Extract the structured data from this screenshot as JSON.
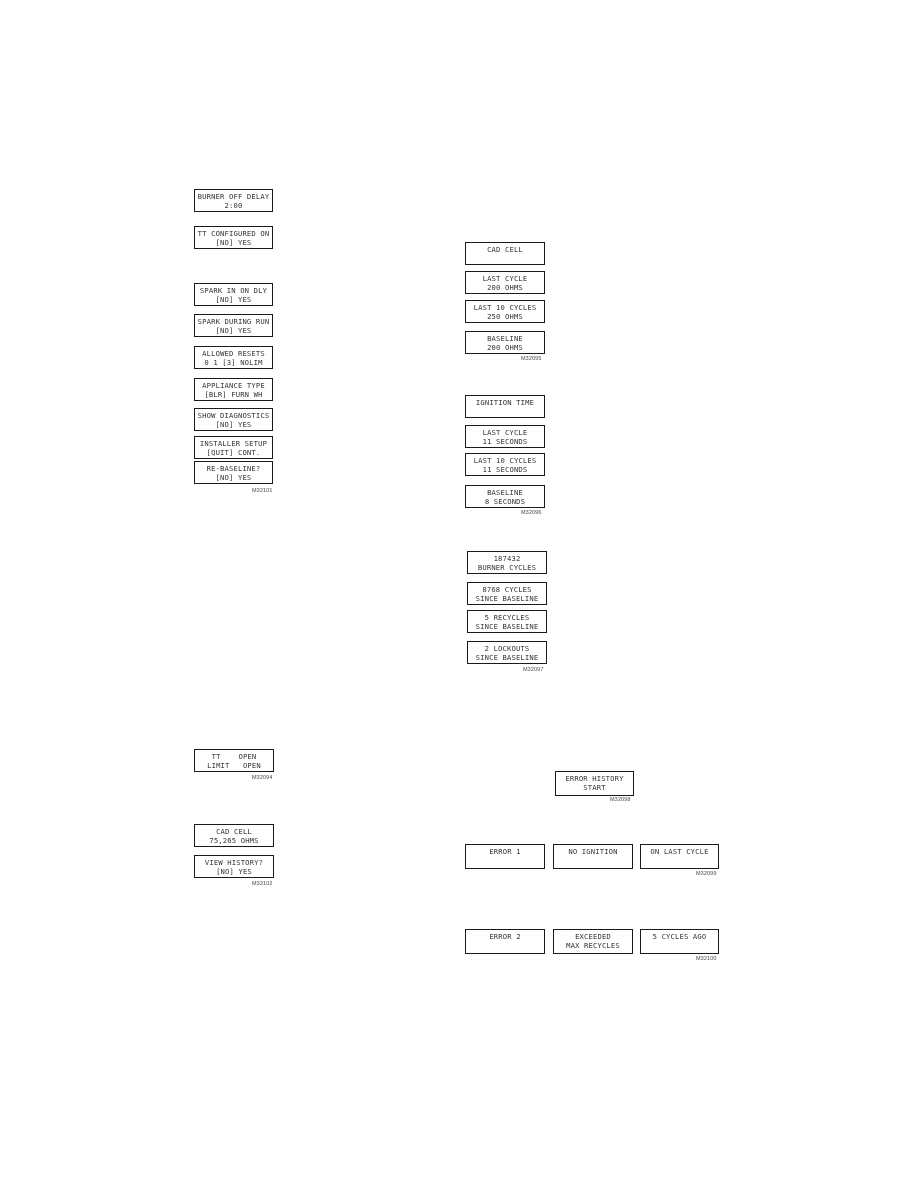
{
  "left_column": {
    "settings_group_a": [
      {
        "line1": "BURNER OFF DELAY",
        "line2": "2:00"
      },
      {
        "line1": "TT CONFIGURED ON",
        "line2": "[NO] YES"
      }
    ],
    "settings_group_b": [
      {
        "line1": "SPARK IN ON DLY",
        "line2": "[NO] YES"
      },
      {
        "line1": "SPARK DURING RUN",
        "line2": "[NO] YES"
      },
      {
        "line1": "ALLOWED RESETS",
        "line2": "0 1 [3] NOLIM"
      },
      {
        "line1": "APPLIANCE TYPE",
        "line2": "[BLR] FURN WH"
      },
      {
        "line1": "SHOW DIAGNOSTICS",
        "line2": "[NO] YES"
      },
      {
        "line1": "INSTALLER SETUP",
        "line2": "[QUIT] CONT."
      },
      {
        "line1": "RE-BASELINE?",
        "line2": "[NO] YES"
      }
    ],
    "settings_group_b_figure": "M32101",
    "status_display": {
      "line1": "TT    OPEN",
      "line2": "LIMIT   OPEN"
    },
    "status_figure": "M32094",
    "cad_cell_group": [
      {
        "line1": "CAD CELL",
        "line2": "75,265 OHMS"
      },
      {
        "line1": "VIEW HISTORY?",
        "line2": "[NO] YES"
      }
    ],
    "cad_cell_figure": "M32102"
  },
  "right_column": {
    "cad_cell_history": [
      {
        "line1": "CAD CELL",
        "line2": ""
      },
      {
        "line1": "LAST CYCLE",
        "line2": "200 OHMS"
      },
      {
        "line1": "LAST 10 CYCLES",
        "line2": "250 OHMS"
      },
      {
        "line1": "BASELINE",
        "line2": "200 OHMS"
      }
    ],
    "cad_cell_history_figure": "M32095",
    "ignition_time_history": [
      {
        "line1": "IGNITION TIME",
        "line2": ""
      },
      {
        "line1": "LAST CYCLE",
        "line2": "11 SECONDS"
      },
      {
        "line1": "LAST 10 CYCLES",
        "line2": "11 SECONDS"
      },
      {
        "line1": "BASELINE",
        "line2": "8 SECONDS"
      }
    ],
    "ignition_time_figure": "M32096",
    "cycle_counts": [
      {
        "line1": "187432",
        "line2": "BURNER CYCLES"
      },
      {
        "line1": "8768 CYCLES",
        "line2": "SINCE BASELINE"
      },
      {
        "line1": "5 RECYCLES",
        "line2": "SINCE BASELINE"
      },
      {
        "line1": "2 LOCKOUTS",
        "line2": "SINCE BASELINE"
      }
    ],
    "cycle_counts_figure": "M32097",
    "error_history_start": {
      "line1": "ERROR HISTORY",
      "line2": "START"
    },
    "error_history_start_figure": "M32098",
    "error_1": [
      {
        "line1": "ERROR 1",
        "line2": ""
      },
      {
        "line1": "NO IGNITION",
        "line2": ""
      },
      {
        "line1": "ON LAST CYCLE",
        "line2": ""
      }
    ],
    "error_1_figure": "M32099",
    "error_2": [
      {
        "line1": "ERROR 2",
        "line2": ""
      },
      {
        "line1": "EXCEEDED",
        "line2": "MAX RECYCLES"
      },
      {
        "line1": "5 CYCLES AGO",
        "line2": ""
      }
    ],
    "error_2_figure": "M32100"
  }
}
